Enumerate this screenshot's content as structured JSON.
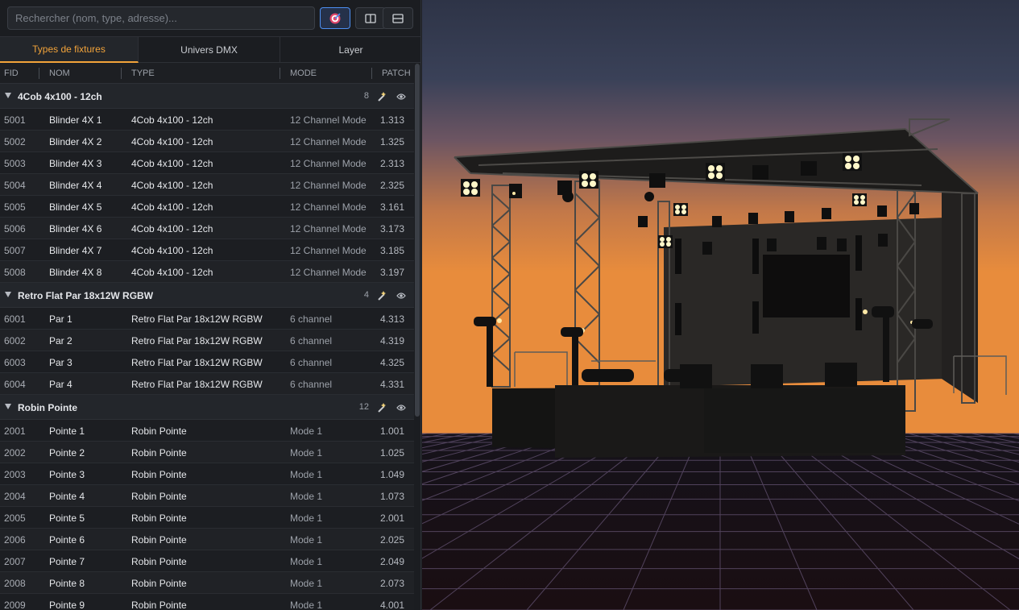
{
  "search": {
    "placeholder": "Rechercher (nom, type, adresse)..."
  },
  "toolbar": {
    "target_icon": "target-icon",
    "split_vertical_icon": "split-vertical-icon",
    "split_horizontal_icon": "split-horizontal-icon"
  },
  "tabs": [
    {
      "label": "Types de fixtures",
      "active": true
    },
    {
      "label": "Univers DMX",
      "active": false
    },
    {
      "label": "Layer",
      "active": false
    }
  ],
  "columns": {
    "fid": "FID",
    "nom": "NOM",
    "type": "TYPE",
    "mode": "MODE",
    "patch": "PATCH"
  },
  "colors": {
    "accent": "#f2a33a",
    "active_button": "#4d8ff2"
  },
  "groups": [
    {
      "name": "4Cob 4x100 - 12ch",
      "count": "8",
      "rows": [
        {
          "fid": "5001",
          "nom": "Blinder 4X 1",
          "type": "4Cob 4x100 - 12ch",
          "mode": "12 Channel Mode",
          "patch": "1.313"
        },
        {
          "fid": "5002",
          "nom": "Blinder 4X 2",
          "type": "4Cob 4x100 - 12ch",
          "mode": "12 Channel Mode",
          "patch": "1.325"
        },
        {
          "fid": "5003",
          "nom": "Blinder 4X 3",
          "type": "4Cob 4x100 - 12ch",
          "mode": "12 Channel Mode",
          "patch": "2.313"
        },
        {
          "fid": "5004",
          "nom": "Blinder 4X 4",
          "type": "4Cob 4x100 - 12ch",
          "mode": "12 Channel Mode",
          "patch": "2.325"
        },
        {
          "fid": "5005",
          "nom": "Blinder 4X 5",
          "type": "4Cob 4x100 - 12ch",
          "mode": "12 Channel Mode",
          "patch": "3.161"
        },
        {
          "fid": "5006",
          "nom": "Blinder 4X 6",
          "type": "4Cob 4x100 - 12ch",
          "mode": "12 Channel Mode",
          "patch": "3.173"
        },
        {
          "fid": "5007",
          "nom": "Blinder 4X 7",
          "type": "4Cob 4x100 - 12ch",
          "mode": "12 Channel Mode",
          "patch": "3.185"
        },
        {
          "fid": "5008",
          "nom": "Blinder 4X 8",
          "type": "4Cob 4x100 - 12ch",
          "mode": "12 Channel Mode",
          "patch": "3.197"
        }
      ]
    },
    {
      "name": "Retro Flat Par 18x12W RGBW",
      "count": "4",
      "rows": [
        {
          "fid": "6001",
          "nom": "Par 1",
          "type": "Retro Flat Par 18x12W RGBW",
          "mode": "6 channel",
          "patch": "4.313"
        },
        {
          "fid": "6002",
          "nom": "Par 2",
          "type": "Retro Flat Par 18x12W RGBW",
          "mode": "6 channel",
          "patch": "4.319"
        },
        {
          "fid": "6003",
          "nom": "Par 3",
          "type": "Retro Flat Par 18x12W RGBW",
          "mode": "6 channel",
          "patch": "4.325"
        },
        {
          "fid": "6004",
          "nom": "Par 4",
          "type": "Retro Flat Par 18x12W RGBW",
          "mode": "6 channel",
          "patch": "4.331"
        }
      ]
    },
    {
      "name": "Robin Pointe",
      "count": "12",
      "rows": [
        {
          "fid": "2001",
          "nom": "Pointe 1",
          "type": "Robin Pointe",
          "mode": "Mode 1",
          "patch": "1.001"
        },
        {
          "fid": "2002",
          "nom": "Pointe 2",
          "type": "Robin Pointe",
          "mode": "Mode 1",
          "patch": "1.025"
        },
        {
          "fid": "2003",
          "nom": "Pointe 3",
          "type": "Robin Pointe",
          "mode": "Mode 1",
          "patch": "1.049"
        },
        {
          "fid": "2004",
          "nom": "Pointe 4",
          "type": "Robin Pointe",
          "mode": "Mode 1",
          "patch": "1.073"
        },
        {
          "fid": "2005",
          "nom": "Pointe 5",
          "type": "Robin Pointe",
          "mode": "Mode 1",
          "patch": "2.001"
        },
        {
          "fid": "2006",
          "nom": "Pointe 6",
          "type": "Robin Pointe",
          "mode": "Mode 1",
          "patch": "2.025"
        },
        {
          "fid": "2007",
          "nom": "Pointe 7",
          "type": "Robin Pointe",
          "mode": "Mode 1",
          "patch": "2.049"
        },
        {
          "fid": "2008",
          "nom": "Pointe 8",
          "type": "Robin Pointe",
          "mode": "Mode 1",
          "patch": "2.073"
        },
        {
          "fid": "2009",
          "nom": "Pointe 9",
          "type": "Robin Pointe",
          "mode": "Mode 1",
          "patch": "4.001"
        }
      ]
    }
  ]
}
